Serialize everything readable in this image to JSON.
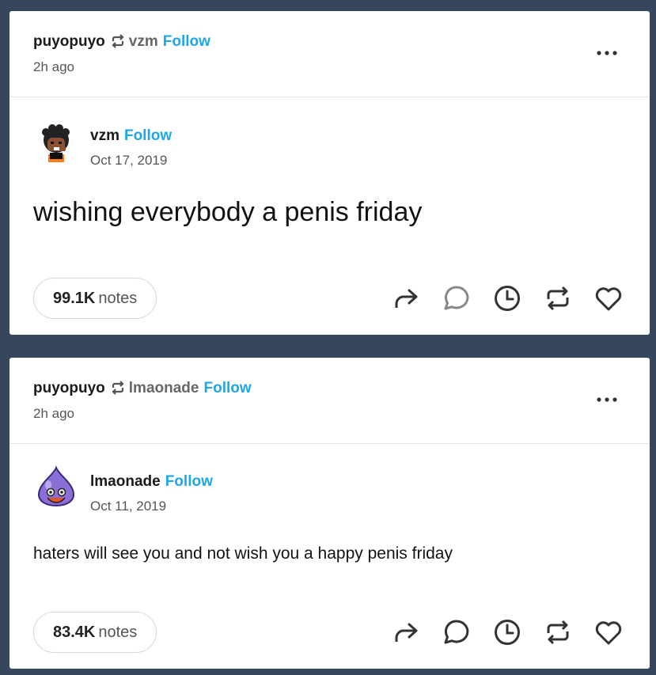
{
  "posts": [
    {
      "reblogger": "puyopuyo",
      "reblog_icon": "reblog-icon",
      "source": "vzm",
      "follow_label": "Follow",
      "time": "2h ago",
      "more_icon": "more-icon",
      "author": "vzm",
      "author_follow_label": "Follow",
      "date": "Oct 17, 2019",
      "text": "wishing everybody a penis friday",
      "notes_count": "99.1K",
      "notes_label": "notes"
    },
    {
      "reblogger": "puyopuyo",
      "reblog_icon": "reblog-icon",
      "source": "lmaonade",
      "follow_label": "Follow",
      "time": "2h ago",
      "more_icon": "more-icon",
      "author": "lmaonade",
      "author_follow_label": "Follow",
      "date": "Oct 11, 2019",
      "text": "haters will see you and not wish you a happy penis friday",
      "notes_count": "83.4K",
      "notes_label": "notes"
    }
  ],
  "action_icons": [
    "share-icon",
    "reply-icon",
    "history-icon",
    "reblog-icon",
    "like-icon"
  ],
  "colors": {
    "background": "#36465d",
    "card": "#ffffff",
    "follow": "#1ea7e8"
  }
}
